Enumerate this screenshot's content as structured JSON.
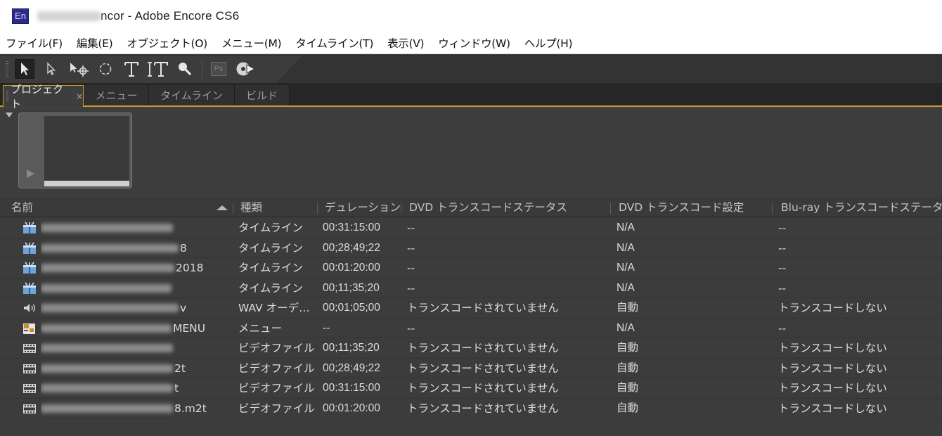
{
  "window": {
    "title_suffix": "ncor - Adobe Encore CS6",
    "app_logo": "En"
  },
  "menubar": [
    "ファイル(F)",
    "編集(E)",
    "オブジェクト(O)",
    "メニュー(M)",
    "タイムライン(T)",
    "表示(V)",
    "ウィンドウ(W)",
    "ヘルプ(H)"
  ],
  "toolbar": {
    "tools": [
      {
        "name": "selection-tool-icon",
        "active": true
      },
      {
        "name": "direct-select-tool-icon",
        "active": false
      },
      {
        "name": "move-tool-icon",
        "active": false
      },
      {
        "name": "rotate-tool-icon",
        "active": false
      },
      {
        "name": "text-tool-icon",
        "active": false
      },
      {
        "name": "vertical-text-tool-icon",
        "active": false
      },
      {
        "name": "zoom-tool-icon",
        "active": false
      },
      {
        "name": "photoshop-edit-icon",
        "active": false
      },
      {
        "name": "preview-disc-icon",
        "active": false
      }
    ],
    "ps_label": "Ps"
  },
  "tabs": [
    {
      "label": "プロジェクト",
      "active": true,
      "close": "×"
    },
    {
      "label": "メニュー",
      "active": false
    },
    {
      "label": "タイムライン",
      "active": false
    },
    {
      "label": "ビルド",
      "active": false
    }
  ],
  "table": {
    "headers": {
      "name": "名前",
      "type": "種類",
      "duration": "デュレーション",
      "dvd_status": "DVD トランスコードステータス",
      "dvd_setting": "DVD トランスコード設定",
      "bluray_status": "Blu-ray トランスコードステータス"
    },
    "rows": [
      {
        "icon": "timeline-icon",
        "name_suffix": "",
        "type": "タイムライン",
        "duration": "00:31:15:00",
        "dvd_status": "--",
        "dvd_setting": "N/A",
        "bluray_status": "--"
      },
      {
        "icon": "timeline-icon",
        "name_suffix": "8",
        "type": "タイムライン",
        "duration": "00;28;49;22",
        "dvd_status": "--",
        "dvd_setting": "N/A",
        "bluray_status": "--"
      },
      {
        "icon": "timeline-icon",
        "name_suffix": "2018",
        "type": "タイムライン",
        "duration": "00:01:20:00",
        "dvd_status": "--",
        "dvd_setting": "N/A",
        "bluray_status": "--"
      },
      {
        "icon": "timeline-icon",
        "name_suffix": "",
        "type": "タイムライン",
        "duration": "00;11;35;20",
        "dvd_status": "--",
        "dvd_setting": "N/A",
        "bluray_status": "--"
      },
      {
        "icon": "audio-icon",
        "name_suffix": "v",
        "type": "WAV オーデ…",
        "duration": "00;01;05;00",
        "dvd_status": "トランスコードされていません",
        "dvd_setting": "自動",
        "bluray_status": "トランスコードしない"
      },
      {
        "icon": "menu-icon",
        "name_suffix": "MENU",
        "type": "メニュー",
        "duration": "--",
        "dvd_status": "--",
        "dvd_setting": "N/A",
        "bluray_status": "--"
      },
      {
        "icon": "video-file-icon",
        "name_suffix": "",
        "type": "ビデオファイル",
        "duration": "00;11;35;20",
        "dvd_status": "トランスコードされていません",
        "dvd_setting": "自動",
        "bluray_status": "トランスコードしない"
      },
      {
        "icon": "video-file-icon",
        "name_suffix": "2t",
        "type": "ビデオファイル",
        "duration": "00;28;49;22",
        "dvd_status": "トランスコードされていません",
        "dvd_setting": "自動",
        "bluray_status": "トランスコードしない"
      },
      {
        "icon": "video-file-icon",
        "name_suffix": "t",
        "type": "ビデオファイル",
        "duration": "00:31:15:00",
        "dvd_status": "トランスコードされていません",
        "dvd_setting": "自動",
        "bluray_status": "トランスコードしない"
      },
      {
        "icon": "video-file-icon",
        "name_suffix": "8.m2t",
        "type": "ビデオファイル",
        "duration": "00:01:20:00",
        "dvd_status": "トランスコードされていません",
        "dvd_setting": "自動",
        "bluray_status": "トランスコードしない"
      }
    ]
  },
  "colors": {
    "panel_bg": "#3c3c3c",
    "accent": "#c89a2c",
    "text": "#dcdcdc",
    "header_text": "#c4c4c4"
  }
}
